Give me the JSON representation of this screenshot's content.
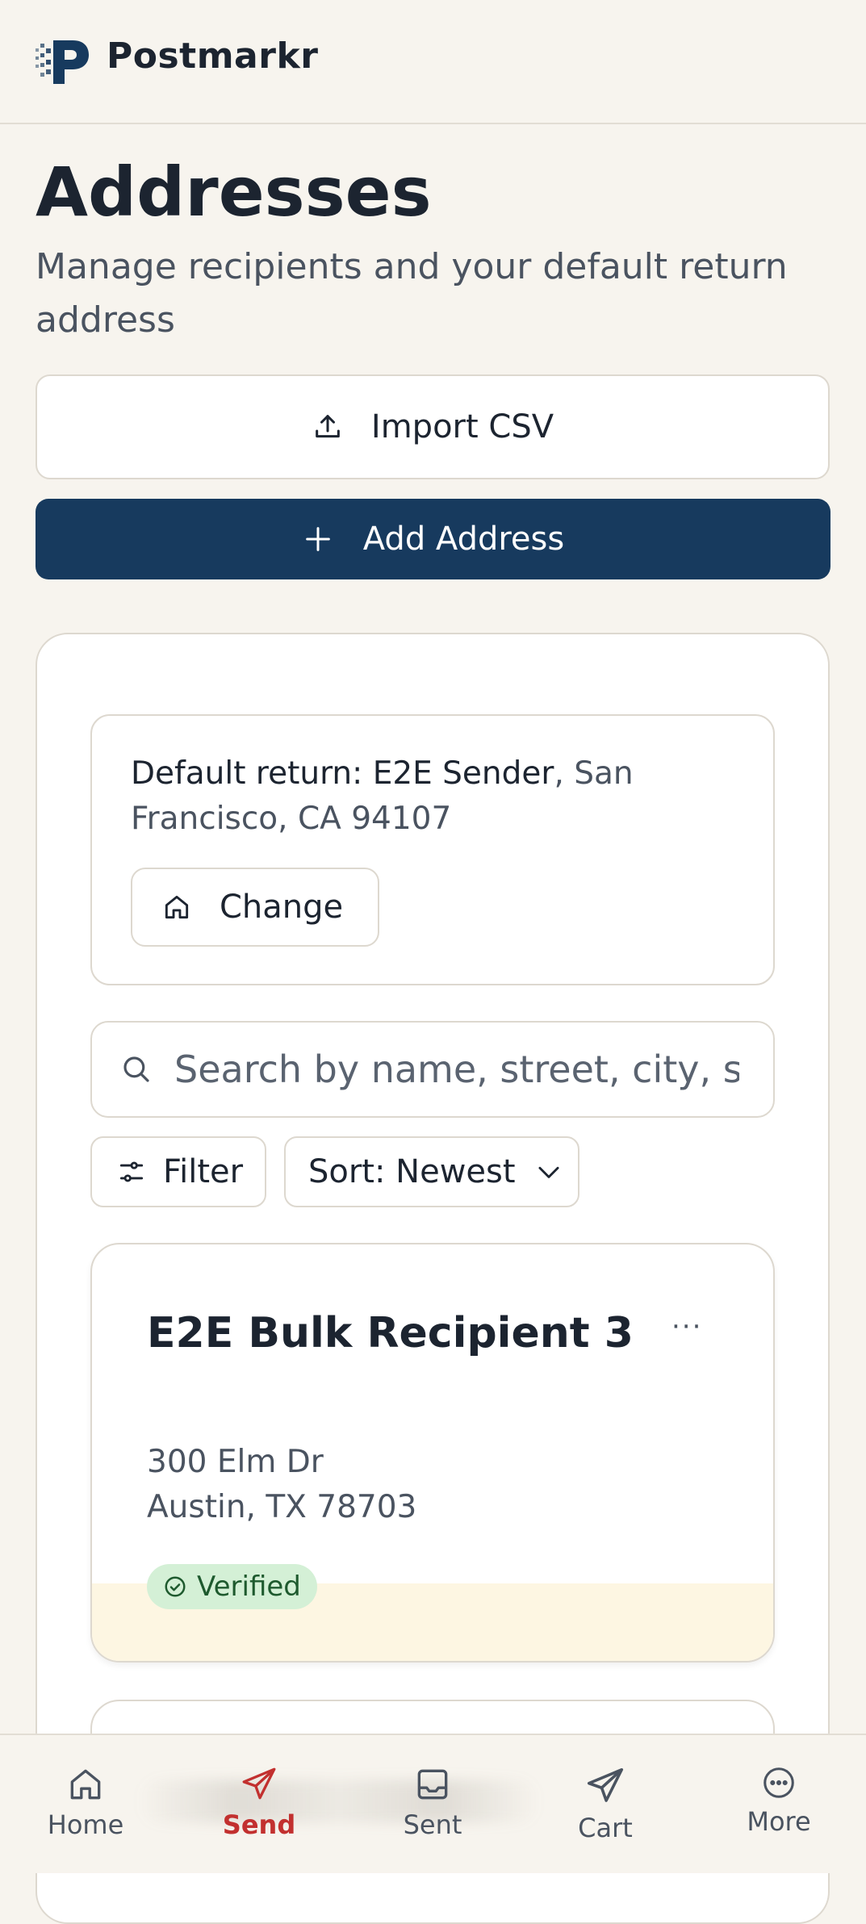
{
  "header": {
    "brand": "Postmarkr",
    "logo_icon": "postmarkr-logo-icon"
  },
  "page": {
    "title": "Addresses",
    "subtitle": "Manage recipients and your default return address"
  },
  "actions": {
    "import_label": "Import CSV",
    "add_label": "Add Address"
  },
  "return_address": {
    "prefix": "Default return: ",
    "name": "E2E Sender",
    "location": ", San Francisco, CA 94107",
    "change_label": "Change"
  },
  "search": {
    "placeholder": "Search by name, street, city, state, or ZIP",
    "value": ""
  },
  "filters": {
    "filter_label": "Filter",
    "sort_label": "Sort: Newest"
  },
  "addresses": [
    {
      "name": "E2E Bulk Recipient 3",
      "more": "···",
      "street": "300 Elm Dr",
      "city_line": "Austin, TX 78703",
      "status": "Verified"
    }
  ],
  "nav": {
    "items": [
      {
        "label": "Home",
        "icon": "home-icon"
      },
      {
        "label": "Send",
        "icon": "send-icon",
        "active": true
      },
      {
        "label": "Sent",
        "icon": "inbox-icon"
      },
      {
        "label": "Cart",
        "icon": "cart-icon"
      },
      {
        "label": "More",
        "icon": "more-icon"
      }
    ]
  },
  "colors": {
    "background": "#f7f4ee",
    "primary": "#173a5e",
    "active_nav": "#c2302f",
    "verified_bg": "#d4f0d6",
    "verified_text": "#1e5a2e"
  }
}
